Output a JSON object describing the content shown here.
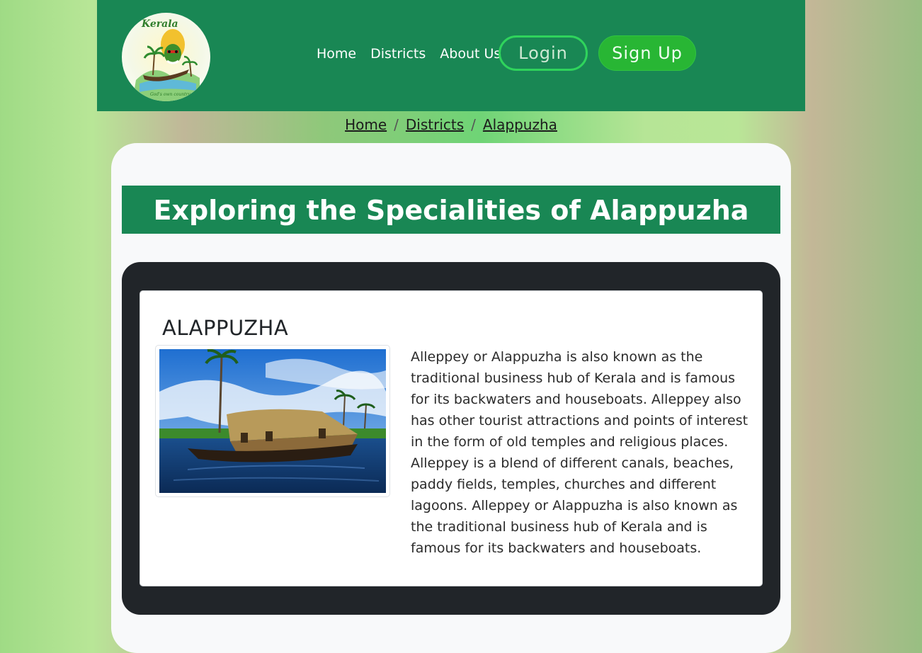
{
  "logo": {
    "text": "Kerala",
    "tagline": "God's own country"
  },
  "nav": {
    "links": [
      "Home",
      "Districts",
      "About Us"
    ],
    "login_label": "Login",
    "signup_label": "Sign Up"
  },
  "breadcrumb": {
    "items": [
      "Home",
      "Districts",
      "Alappuzha"
    ],
    "separator": "/"
  },
  "page_title": "Exploring the Specialities of Alappuzha",
  "card": {
    "title": "ALAPPUZHA",
    "image_subject": "houseboat on backwaters",
    "description": "Alleppey or Alappuzha is also known as the traditional business hub of Kerala and is famous for its backwaters and houseboats. Alleppey also has other tourist attractions and points of interest in the form of old temples and religious places. Alleppey is a blend of different canals, beaches, paddy fields, temples, churches and different lagoons. Alleppey or Alappuzha is also known as the traditional business hub of Kerala and is famous for its backwaters and houseboats."
  },
  "colors": {
    "navbar": "#198754",
    "login_border": "#2fd45c",
    "signup_bg": "#28b634",
    "dark_panel": "#212529"
  }
}
